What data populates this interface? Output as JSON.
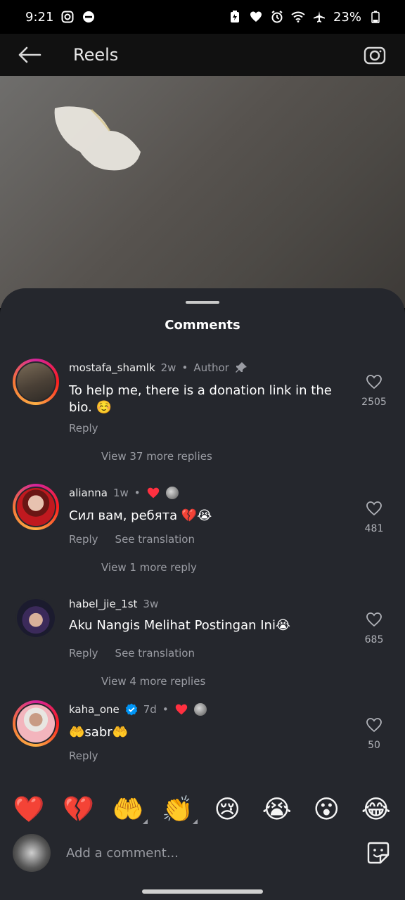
{
  "status_bar": {
    "time": "9:21",
    "battery": "23%",
    "icons": [
      "instagram-icon",
      "dnd-icon",
      "battery-saver-icon",
      "heart-icon",
      "alarm-icon",
      "wifi-icon",
      "airplane-icon",
      "battery-icon"
    ]
  },
  "header": {
    "title": "Reels"
  },
  "sheet": {
    "title": "Comments"
  },
  "comments": [
    {
      "username": "mostafa_shamlk",
      "time": "2w",
      "author_label": "Author",
      "text": "To help me, there is a donation link in the bio. ☺️",
      "reply_label": "Reply",
      "likes": "2505",
      "view_replies": "View 37 more replies"
    },
    {
      "username": "alianna",
      "time": "1w",
      "text": "Сил вам, ребята 💔😭",
      "reply_label": "Reply",
      "translate_label": "See translation",
      "likes": "481",
      "view_replies": "View 1 more reply"
    },
    {
      "username": "habel_jie_1st",
      "time": "3w",
      "text": "Aku Nangis Melihat Postingan Ini😭",
      "reply_label": "Reply",
      "translate_label": "See translation",
      "likes": "685",
      "view_replies": "View 4 more replies"
    },
    {
      "username": "kaha_one",
      "time": "7d",
      "text": "🤲sabr🤲",
      "reply_label": "Reply",
      "likes": "50"
    }
  ],
  "emoji_bar": [
    "❤️",
    "💔",
    "🤲",
    "👏",
    "😢",
    "😭",
    "😮",
    "😂"
  ],
  "composer": {
    "placeholder": "Add a comment..."
  },
  "colors": {
    "sheet_bg": "#25272d",
    "heart_red": "#ff3040",
    "verified_blue": "#0095f6"
  }
}
